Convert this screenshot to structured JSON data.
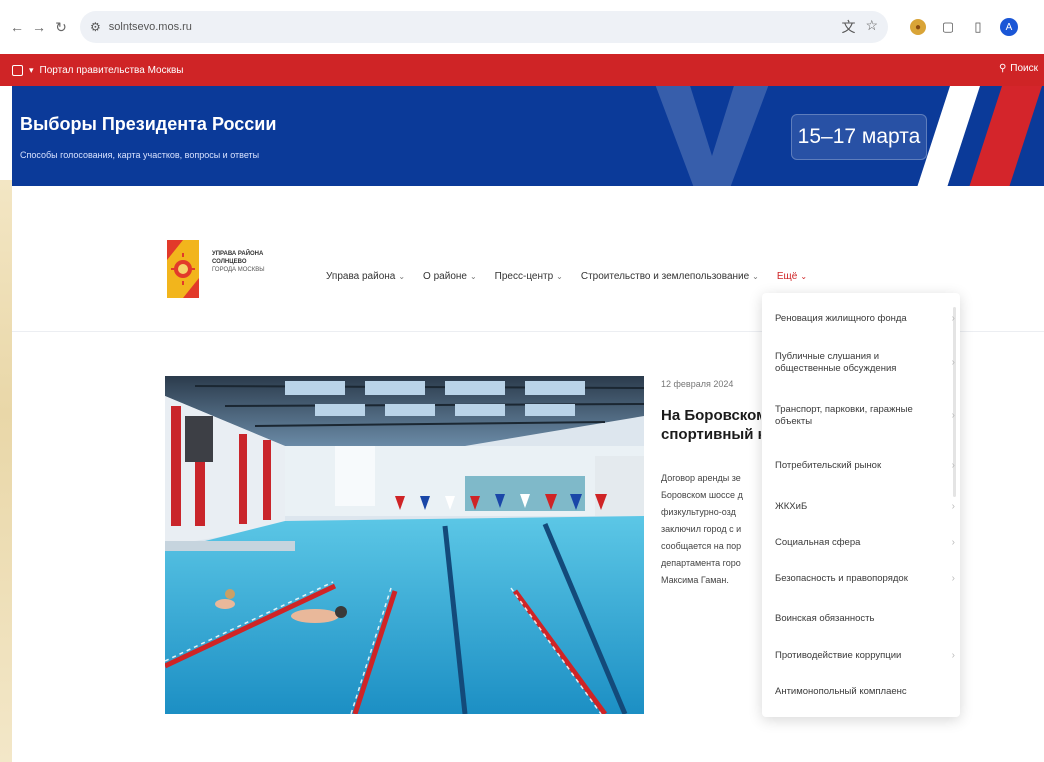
{
  "browser": {
    "url": "solntsevo.mos.ru",
    "profile_initial": "A"
  },
  "portal_bar": {
    "title": "Портал правительства Москвы",
    "search_label": "Поиск"
  },
  "banner": {
    "title": "Выборы Президента России",
    "subtitle": "Способы голосования, карта участков, вопросы и ответы",
    "dates": "15–17 марта"
  },
  "logo": {
    "line1": "УПРАВА РАЙОНА",
    "line2": "СОЛНЦЕВО",
    "line3": "ГОРОДА МОСКВЫ"
  },
  "nav": [
    {
      "label": "Управа района"
    },
    {
      "label": "О районе"
    },
    {
      "label": "Пресс-центр"
    },
    {
      "label": "Строительство и землепользование"
    },
    {
      "label": "Ещё"
    }
  ],
  "news": {
    "date": "12 февраля 2024",
    "title_line1": "На Боровском",
    "title_line2": "спортивный к",
    "text_lines": [
      "Договор аренды зе",
      "Боровском шоссе д",
      "физкультурно-озд",
      "заключил город с и",
      "сообщается на пор",
      "департамента горо",
      "Максима Гаман."
    ]
  },
  "dropdown": [
    {
      "label": "Реновация жилищного фонда",
      "arrow": "›"
    },
    {
      "label": "Публичные слушания и общественные обсуждения",
      "arrow": "›"
    },
    {
      "label": "Транспорт, парковки, гаражные объекты",
      "arrow": "›"
    },
    {
      "label": "Потребительский рынок",
      "arrow": "›"
    },
    {
      "label": "ЖКХиБ",
      "arrow": "›"
    },
    {
      "label": "Социальная сфера",
      "arrow": "›"
    },
    {
      "label": "Безопасность и правопорядок",
      "arrow": "›"
    },
    {
      "label": "Воинская обязанность",
      "arrow": ""
    },
    {
      "label": "Противодействие коррупции",
      "arrow": "›"
    },
    {
      "label": "Антимонопольный комплаенс",
      "arrow": ""
    }
  ]
}
